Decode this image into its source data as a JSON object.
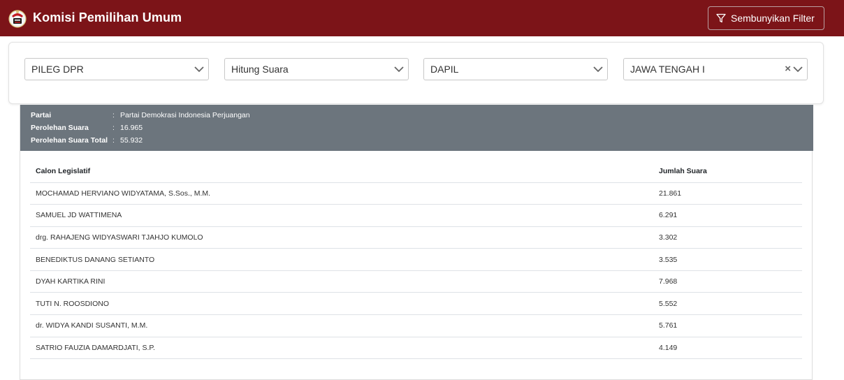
{
  "header": {
    "title": "Komisi Pemilihan Umum",
    "filter_button": "Sembunyikan Filter"
  },
  "filters": [
    {
      "value": "PILEG DPR",
      "clearable": false
    },
    {
      "value": "Hitung Suara",
      "clearable": false
    },
    {
      "value": "DAPIL",
      "clearable": false
    },
    {
      "value": "JAWA TENGAH I",
      "clearable": true
    }
  ],
  "party_info": {
    "rows": [
      {
        "label": "Partai",
        "value": "Partai Demokrasi Indonesia Perjuangan"
      },
      {
        "label": "Perolehan Suara",
        "value": "16.965"
      },
      {
        "label": "Perolehan Suara Total",
        "value": "55.932"
      }
    ],
    "separator": ":"
  },
  "table": {
    "headers": [
      "Calon Legislatif",
      "Jumlah Suara"
    ],
    "rows": [
      {
        "name": "MOCHAMAD HERVIANO WIDYATAMA, S.Sos., M.M.",
        "votes": "21.861"
      },
      {
        "name": "SAMUEL JD WATTIMENA",
        "votes": "6.291"
      },
      {
        "name": "drg. RAHAJENG WIDYASWARI TJAHJO KUMOLO",
        "votes": "3.302"
      },
      {
        "name": "BENEDIKTUS DANANG SETIANTO",
        "votes": "3.535"
      },
      {
        "name": "DYAH KARTIKA RINI",
        "votes": "7.968"
      },
      {
        "name": "TUTI N. ROOSDIONO",
        "votes": "5.552"
      },
      {
        "name": "dr. WIDYA KANDI SUSANTI, M.M.",
        "votes": "5.761"
      },
      {
        "name": "SATRIO FAUZIA DAMARDJATI, S.P.",
        "votes": "4.149"
      }
    ]
  },
  "colors": {
    "header_bg": "#7c1418",
    "party_info_bg": "#6c757d"
  }
}
